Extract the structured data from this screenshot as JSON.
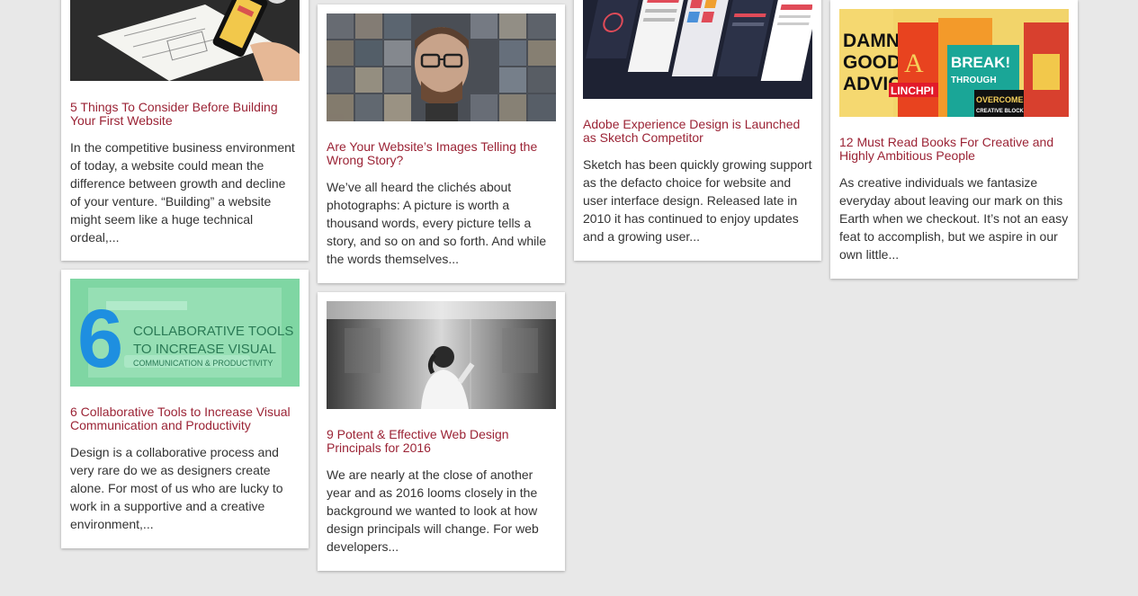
{
  "colors": {
    "background": "#e8e8e8",
    "card": "#ffffff",
    "title": "#9b2335",
    "text": "#333333"
  },
  "posts": [
    {
      "title": "5 Things To Consider Before Building Your First Website",
      "excerpt": "In the competitive business environment of today, a website could mean the difference between growth and decline of your venture. “Building” a website might seem like a huge technical ordeal,...",
      "image": "hand-holding-phone-over-wireframe-sketches"
    },
    {
      "title": "Are Your Website’s Images Telling the Wrong Story?",
      "excerpt": "We’ve all heard the clichés about photographs: A picture is worth a thousand words, every picture tells a story, and so on and so forth. And while the words themselves...",
      "image": "man-with-glasses-surrounded-by-photo-grid"
    },
    {
      "title": "Adobe Experience Design is Launched as Sketch Competitor",
      "excerpt": "Sketch has been quickly growing support as the defacto choice for website and user interface design. Released late in 2010 it has continued to enjoy updates and a growing user...",
      "image": "mobile-app-screen-mockups"
    },
    {
      "title": "12 Must Read Books For Creative and Highly Ambitious People",
      "excerpt": "As creative individuals we fantasize everyday about leaving our mark on this Earth when we checkout. It’s not an easy feat to accomplish, but we aspire in our own little...",
      "image": "colorful-book-covers-collage",
      "image_text": [
        "DAMN",
        "GOOD",
        "ADVIC",
        "LINCHPI",
        "BREAK!",
        "THROUGH",
        "OVERCOME",
        "CREATIVE BLOCK"
      ]
    },
    {
      "title": "6 Collaborative Tools to Increase Visual Communication and Productivity",
      "excerpt": "Design is a collaborative process and very rare do we as designers create alone. For most of us who are lucky to work in a supportive and a creative environment,...",
      "image": "green-banner-six-collaborative-tools",
      "image_text": [
        "6",
        "COLLABORATIVE TOOLS",
        "TO INCREASE VISUAL",
        "COMMUNICATION & PRODUCTIVITY"
      ]
    },
    {
      "title": "9 Potent & Effective Web Design Principals for 2016",
      "excerpt": "We are nearly at the close of another year and as 2016 looms closely in the background we wanted to look at how design principals will change. For web developers...",
      "image": "woman-in-white-on-blurred-subway"
    }
  ]
}
